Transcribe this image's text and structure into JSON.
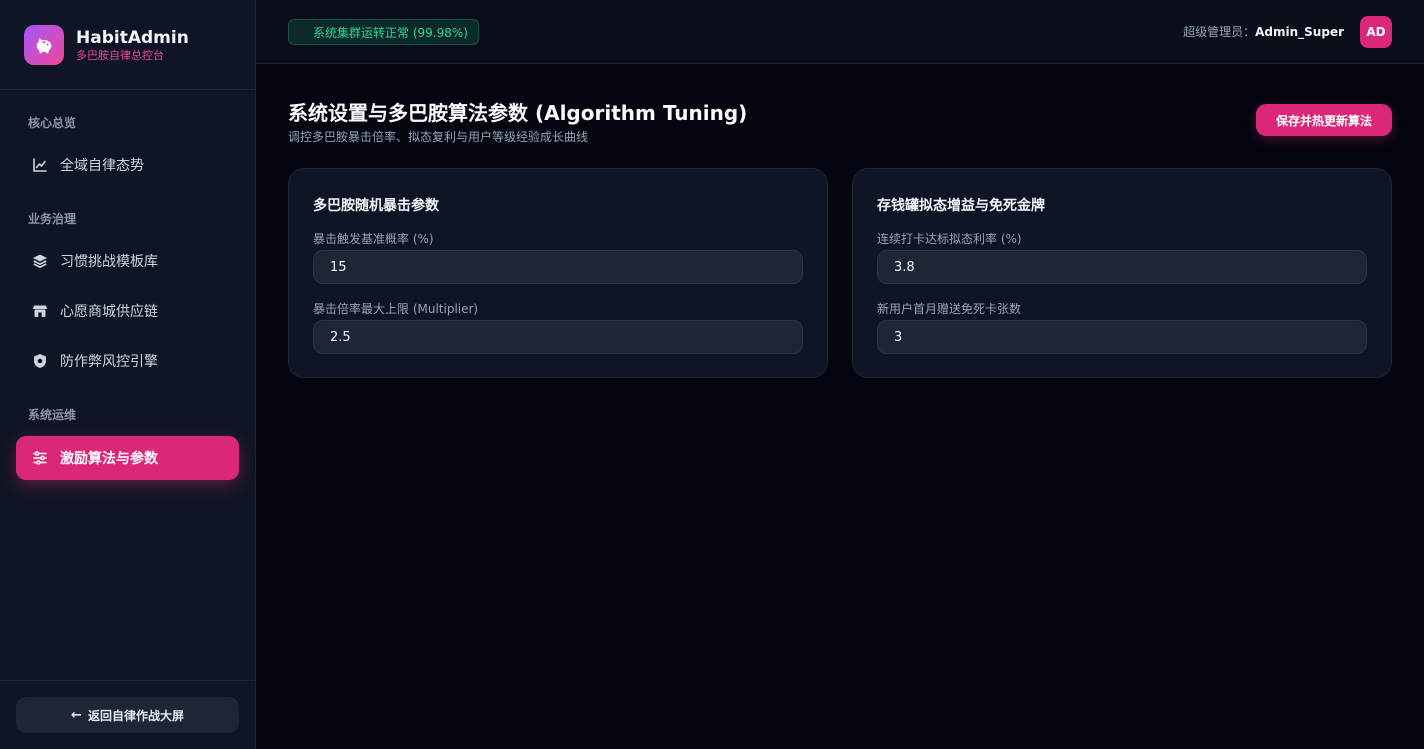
{
  "brand": {
    "title": "HabitAdmin",
    "subtitle": "多巴胺自律总控台",
    "logo_icon": "piggy-bank-icon"
  },
  "sidebar": {
    "sections": [
      {
        "label": "核心总览"
      },
      {
        "label": "业务治理"
      },
      {
        "label": "系统运维"
      }
    ],
    "items": [
      {
        "label": "全域自律态势",
        "icon": "chart-line-icon",
        "active": false
      },
      {
        "label": "习惯挑战模板库",
        "icon": "layers-icon",
        "active": false
      },
      {
        "label": "心愿商城供应链",
        "icon": "store-icon",
        "active": false
      },
      {
        "label": "防作弊风控引擎",
        "icon": "shield-icon",
        "active": false
      },
      {
        "label": "激励算法与参数",
        "icon": "sliders-icon",
        "active": true
      }
    ],
    "back_button": "返回自律作战大屏"
  },
  "header": {
    "status": "系统集群运转正常 (99.98%)",
    "admin_prefix": "超级管理员：",
    "admin_name": "Admin_Super",
    "avatar": "AD"
  },
  "main": {
    "title": "系统设置与多巴胺算法参数 (Algorithm Tuning)",
    "subtitle": "调控多巴胺暴击倍率、拟态复利与用户等级经验成长曲线",
    "save_button": "保存并热更新算法",
    "cards": [
      {
        "title": "多巴胺随机暴击参数",
        "fields": [
          {
            "label": "暴击触发基准概率 (%)",
            "value": "15"
          },
          {
            "label": "暴击倍率最大上限 (Multiplier)",
            "value": "2.5"
          }
        ]
      },
      {
        "title": "存钱罐拟态增益与免死金牌",
        "fields": [
          {
            "label": "连续打卡达标拟态利率 (%)",
            "value": "3.8"
          },
          {
            "label": "新用户首月赠送免死卡张数",
            "value": "3"
          }
        ]
      }
    ]
  },
  "colors": {
    "accent": "#db2777",
    "status_green": "#34d399",
    "background": "#03050f",
    "panel": "#0f1524"
  }
}
